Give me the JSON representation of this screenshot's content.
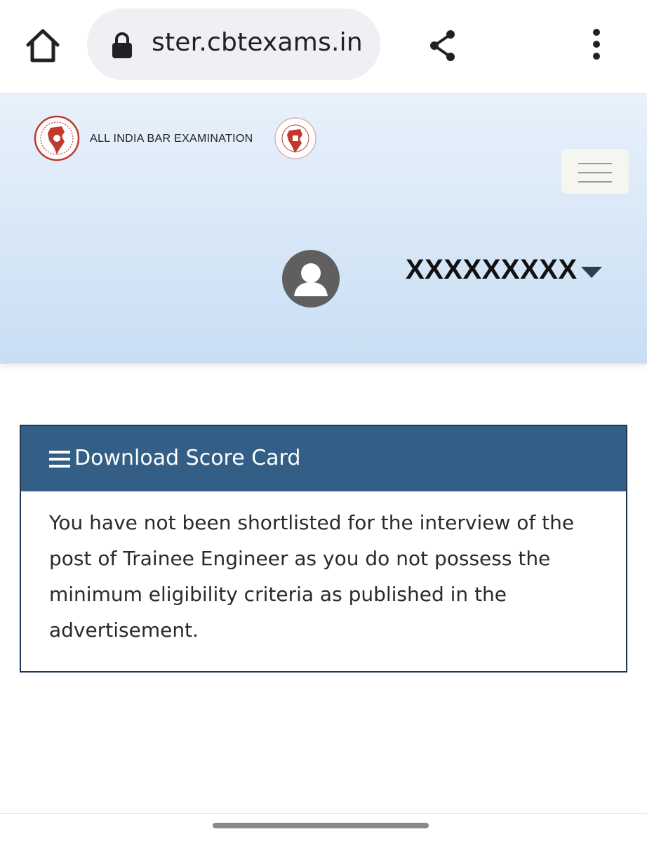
{
  "browser": {
    "url": "ster.cbtexams.in",
    "icons": {
      "home": "home-icon",
      "lock": "lock-icon",
      "share": "share-icon",
      "menu": "more-vert-icon"
    }
  },
  "header": {
    "title": "ALL INDIA BAR EXAMINATION",
    "user_name": "XXXXXXXXX",
    "icons": {
      "logo_left": "emblem-logo",
      "logo_right": "bar-council-logo",
      "menu": "hamburger-icon",
      "avatar": "user-avatar-icon",
      "caret": "caret-down-icon"
    }
  },
  "panel": {
    "title": "Download Score Card",
    "body_lines": [
      "You have not been shortlisted for the interview of the",
      "post of Trainee Engineer as you do not possess the",
      "minimum eligibility criteria as published in the",
      "advertisement."
    ]
  },
  "colors": {
    "panel_header": "#335f86",
    "panel_border": "#1f3550",
    "logo_red": "#c0392b",
    "header_bg_top": "#e8f1fb",
    "header_bg_bottom": "#c9def4"
  }
}
